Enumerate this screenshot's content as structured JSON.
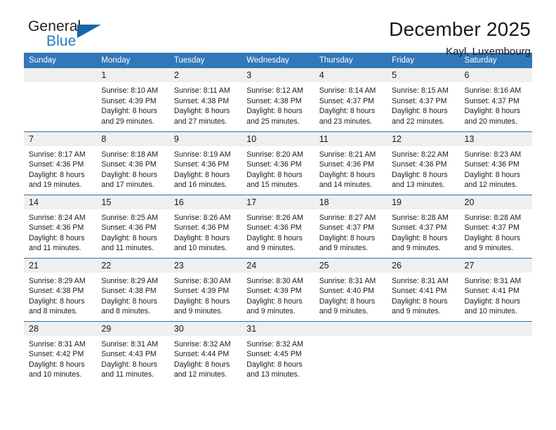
{
  "brand": {
    "name_top": "General",
    "name_bottom": "Blue",
    "accent_color": "#1f7cc4",
    "triangle_color": "#1565a8"
  },
  "header": {
    "title": "December 2025",
    "subtitle": "Kayl, Luxembourg"
  },
  "theme": {
    "header_row_bg": "#3277b8",
    "header_row_text": "#ffffff",
    "daynum_band_bg": "#efefef",
    "row_separator": "#2f6fae"
  },
  "weekdays": [
    "Sunday",
    "Monday",
    "Tuesday",
    "Wednesday",
    "Thursday",
    "Friday",
    "Saturday"
  ],
  "weeks": [
    [
      {
        "day": "",
        "sunrise": "",
        "sunset": "",
        "daylight_line1": "",
        "daylight_line2": "",
        "empty": true
      },
      {
        "day": "1",
        "sunrise": "Sunrise: 8:10 AM",
        "sunset": "Sunset: 4:39 PM",
        "daylight_line1": "Daylight: 8 hours",
        "daylight_line2": "and 29 minutes."
      },
      {
        "day": "2",
        "sunrise": "Sunrise: 8:11 AM",
        "sunset": "Sunset: 4:38 PM",
        "daylight_line1": "Daylight: 8 hours",
        "daylight_line2": "and 27 minutes."
      },
      {
        "day": "3",
        "sunrise": "Sunrise: 8:12 AM",
        "sunset": "Sunset: 4:38 PM",
        "daylight_line1": "Daylight: 8 hours",
        "daylight_line2": "and 25 minutes."
      },
      {
        "day": "4",
        "sunrise": "Sunrise: 8:14 AM",
        "sunset": "Sunset: 4:37 PM",
        "daylight_line1": "Daylight: 8 hours",
        "daylight_line2": "and 23 minutes."
      },
      {
        "day": "5",
        "sunrise": "Sunrise: 8:15 AM",
        "sunset": "Sunset: 4:37 PM",
        "daylight_line1": "Daylight: 8 hours",
        "daylight_line2": "and 22 minutes."
      },
      {
        "day": "6",
        "sunrise": "Sunrise: 8:16 AM",
        "sunset": "Sunset: 4:37 PM",
        "daylight_line1": "Daylight: 8 hours",
        "daylight_line2": "and 20 minutes."
      }
    ],
    [
      {
        "day": "7",
        "sunrise": "Sunrise: 8:17 AM",
        "sunset": "Sunset: 4:36 PM",
        "daylight_line1": "Daylight: 8 hours",
        "daylight_line2": "and 19 minutes."
      },
      {
        "day": "8",
        "sunrise": "Sunrise: 8:18 AM",
        "sunset": "Sunset: 4:36 PM",
        "daylight_line1": "Daylight: 8 hours",
        "daylight_line2": "and 17 minutes."
      },
      {
        "day": "9",
        "sunrise": "Sunrise: 8:19 AM",
        "sunset": "Sunset: 4:36 PM",
        "daylight_line1": "Daylight: 8 hours",
        "daylight_line2": "and 16 minutes."
      },
      {
        "day": "10",
        "sunrise": "Sunrise: 8:20 AM",
        "sunset": "Sunset: 4:36 PM",
        "daylight_line1": "Daylight: 8 hours",
        "daylight_line2": "and 15 minutes."
      },
      {
        "day": "11",
        "sunrise": "Sunrise: 8:21 AM",
        "sunset": "Sunset: 4:36 PM",
        "daylight_line1": "Daylight: 8 hours",
        "daylight_line2": "and 14 minutes."
      },
      {
        "day": "12",
        "sunrise": "Sunrise: 8:22 AM",
        "sunset": "Sunset: 4:36 PM",
        "daylight_line1": "Daylight: 8 hours",
        "daylight_line2": "and 13 minutes."
      },
      {
        "day": "13",
        "sunrise": "Sunrise: 8:23 AM",
        "sunset": "Sunset: 4:36 PM",
        "daylight_line1": "Daylight: 8 hours",
        "daylight_line2": "and 12 minutes."
      }
    ],
    [
      {
        "day": "14",
        "sunrise": "Sunrise: 8:24 AM",
        "sunset": "Sunset: 4:36 PM",
        "daylight_line1": "Daylight: 8 hours",
        "daylight_line2": "and 11 minutes."
      },
      {
        "day": "15",
        "sunrise": "Sunrise: 8:25 AM",
        "sunset": "Sunset: 4:36 PM",
        "daylight_line1": "Daylight: 8 hours",
        "daylight_line2": "and 11 minutes."
      },
      {
        "day": "16",
        "sunrise": "Sunrise: 8:26 AM",
        "sunset": "Sunset: 4:36 PM",
        "daylight_line1": "Daylight: 8 hours",
        "daylight_line2": "and 10 minutes."
      },
      {
        "day": "17",
        "sunrise": "Sunrise: 8:26 AM",
        "sunset": "Sunset: 4:36 PM",
        "daylight_line1": "Daylight: 8 hours",
        "daylight_line2": "and 9 minutes."
      },
      {
        "day": "18",
        "sunrise": "Sunrise: 8:27 AM",
        "sunset": "Sunset: 4:37 PM",
        "daylight_line1": "Daylight: 8 hours",
        "daylight_line2": "and 9 minutes."
      },
      {
        "day": "19",
        "sunrise": "Sunrise: 8:28 AM",
        "sunset": "Sunset: 4:37 PM",
        "daylight_line1": "Daylight: 8 hours",
        "daylight_line2": "and 9 minutes."
      },
      {
        "day": "20",
        "sunrise": "Sunrise: 8:28 AM",
        "sunset": "Sunset: 4:37 PM",
        "daylight_line1": "Daylight: 8 hours",
        "daylight_line2": "and 9 minutes."
      }
    ],
    [
      {
        "day": "21",
        "sunrise": "Sunrise: 8:29 AM",
        "sunset": "Sunset: 4:38 PM",
        "daylight_line1": "Daylight: 8 hours",
        "daylight_line2": "and 8 minutes."
      },
      {
        "day": "22",
        "sunrise": "Sunrise: 8:29 AM",
        "sunset": "Sunset: 4:38 PM",
        "daylight_line1": "Daylight: 8 hours",
        "daylight_line2": "and 8 minutes."
      },
      {
        "day": "23",
        "sunrise": "Sunrise: 8:30 AM",
        "sunset": "Sunset: 4:39 PM",
        "daylight_line1": "Daylight: 8 hours",
        "daylight_line2": "and 9 minutes."
      },
      {
        "day": "24",
        "sunrise": "Sunrise: 8:30 AM",
        "sunset": "Sunset: 4:39 PM",
        "daylight_line1": "Daylight: 8 hours",
        "daylight_line2": "and 9 minutes."
      },
      {
        "day": "25",
        "sunrise": "Sunrise: 8:31 AM",
        "sunset": "Sunset: 4:40 PM",
        "daylight_line1": "Daylight: 8 hours",
        "daylight_line2": "and 9 minutes."
      },
      {
        "day": "26",
        "sunrise": "Sunrise: 8:31 AM",
        "sunset": "Sunset: 4:41 PM",
        "daylight_line1": "Daylight: 8 hours",
        "daylight_line2": "and 9 minutes."
      },
      {
        "day": "27",
        "sunrise": "Sunrise: 8:31 AM",
        "sunset": "Sunset: 4:41 PM",
        "daylight_line1": "Daylight: 8 hours",
        "daylight_line2": "and 10 minutes."
      }
    ],
    [
      {
        "day": "28",
        "sunrise": "Sunrise: 8:31 AM",
        "sunset": "Sunset: 4:42 PM",
        "daylight_line1": "Daylight: 8 hours",
        "daylight_line2": "and 10 minutes."
      },
      {
        "day": "29",
        "sunrise": "Sunrise: 8:31 AM",
        "sunset": "Sunset: 4:43 PM",
        "daylight_line1": "Daylight: 8 hours",
        "daylight_line2": "and 11 minutes."
      },
      {
        "day": "30",
        "sunrise": "Sunrise: 8:32 AM",
        "sunset": "Sunset: 4:44 PM",
        "daylight_line1": "Daylight: 8 hours",
        "daylight_line2": "and 12 minutes."
      },
      {
        "day": "31",
        "sunrise": "Sunrise: 8:32 AM",
        "sunset": "Sunset: 4:45 PM",
        "daylight_line1": "Daylight: 8 hours",
        "daylight_line2": "and 13 minutes."
      },
      {
        "day": "",
        "sunrise": "",
        "sunset": "",
        "daylight_line1": "",
        "daylight_line2": "",
        "empty": true
      },
      {
        "day": "",
        "sunrise": "",
        "sunset": "",
        "daylight_line1": "",
        "daylight_line2": "",
        "empty": true
      },
      {
        "day": "",
        "sunrise": "",
        "sunset": "",
        "daylight_line1": "",
        "daylight_line2": "",
        "empty": true
      }
    ]
  ]
}
